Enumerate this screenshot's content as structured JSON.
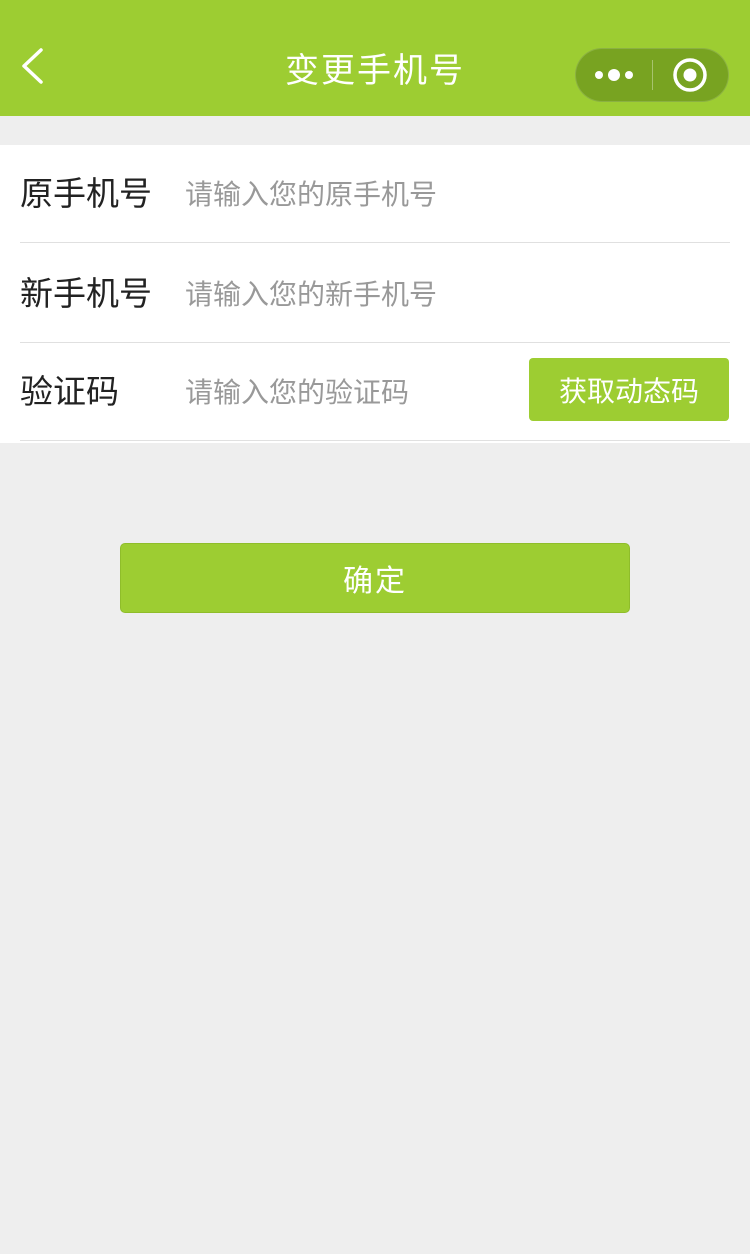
{
  "header": {
    "title": "变更手机号",
    "back_icon": "chevron-left-icon",
    "more_icon": "more-dots-icon",
    "close_icon": "target-circle-icon",
    "background_color": "#9dcd32"
  },
  "form": {
    "rows": [
      {
        "label": "原手机号",
        "placeholder": "请输入您的原手机号",
        "value": ""
      },
      {
        "label": "新手机号",
        "placeholder": "请输入您的新手机号",
        "value": ""
      },
      {
        "label": "验证码",
        "placeholder": "请输入您的验证码",
        "value": ""
      }
    ],
    "code_button_label": "获取动态码"
  },
  "confirm": {
    "label": "确定"
  },
  "colors": {
    "accent": "#9dcd32",
    "page_background": "#eeeeee",
    "label_text": "#222222",
    "placeholder_text": "#999999"
  }
}
